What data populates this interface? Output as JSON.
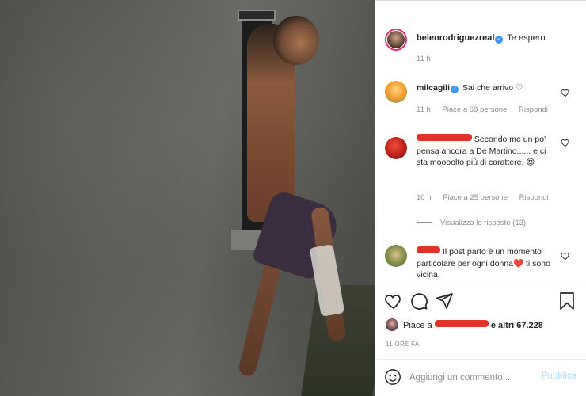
{
  "post": {
    "image_icon": "photo-woman-sitting-in-window",
    "author": {
      "username": "belenrodriguezreal",
      "caption": "Te espero",
      "time": "11 h",
      "verified_icon": "verified-badge-icon"
    }
  },
  "comments": [
    {
      "username": "milcagili",
      "verified": true,
      "text": "Sai che arrivo ♡",
      "time": "11 h",
      "likes": "Piace a 68 persone",
      "reply": "Rispondi"
    },
    {
      "username": "",
      "text": "Secondo me un po' pensa ancora a De Martino...... e ci sta moooolto più di carattere. 😍",
      "time": "10 h",
      "likes": "Piace a 25 persone",
      "reply": "Rispondi",
      "view_replies": "Visualizza le risposte (13)"
    },
    {
      "username": "",
      "text": "Il post parto è un momento particolare per ogni donna❤️ ti sono vicina"
    }
  ],
  "actions": {
    "like_icon": "heart-icon",
    "comment_icon": "comment-icon",
    "share_icon": "send-icon",
    "save_icon": "bookmark-icon"
  },
  "likes_summary": {
    "prefix": "Piace a",
    "suffix_bold": "e altri 67.228"
  },
  "post_time": "11 ORE FA",
  "add_comment": {
    "emoji_icon": "smiley-icon",
    "placeholder": "Aggiungi un commento...",
    "publish_label": "Pubblica"
  },
  "colors": {
    "link_blue_disabled": "#b2dffc",
    "verified_blue": "#3897f0",
    "redaction_red": "#e0332a",
    "muted_text": "#8e8e8e"
  }
}
